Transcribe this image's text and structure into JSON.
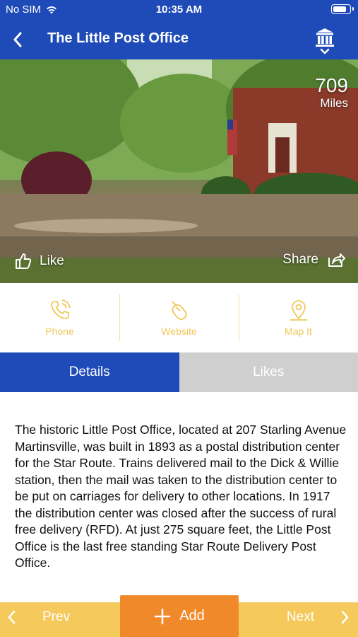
{
  "status_bar": {
    "carrier": "No SIM",
    "time": "10:35 AM"
  },
  "nav": {
    "title": "The Little Post Office"
  },
  "hero": {
    "distance_value": "709",
    "distance_unit": "Miles",
    "like_label": "Like",
    "share_label": "Share"
  },
  "actions": [
    {
      "label": "Phone",
      "icon": "phone-icon"
    },
    {
      "label": "Website",
      "icon": "mouse-icon"
    },
    {
      "label": "Map It",
      "icon": "map-pin-icon"
    }
  ],
  "tabs": {
    "details": "Details",
    "likes": "Likes"
  },
  "description": "The historic Little Post Office, located at 207 Starling Avenue Martinsville, was built in 1893 as a postal distribution center for the Star Route. Trains delivered mail to the Dick & Willie station, then the mail was taken to the distribution center to be put on carriages for delivery to other locations. In 1917 the distribution center was closed after the success of rural free delivery (RFD). At just 275 square feet, the Little Post Office is the last free standing Star Route Delivery Post Office.",
  "bottom": {
    "prev": "Prev",
    "add": "Add",
    "next": "Next"
  },
  "colors": {
    "primary": "#1f4bb8",
    "accent": "#f0892a",
    "bar": "#f5c95c",
    "action": "#f0c75a"
  }
}
